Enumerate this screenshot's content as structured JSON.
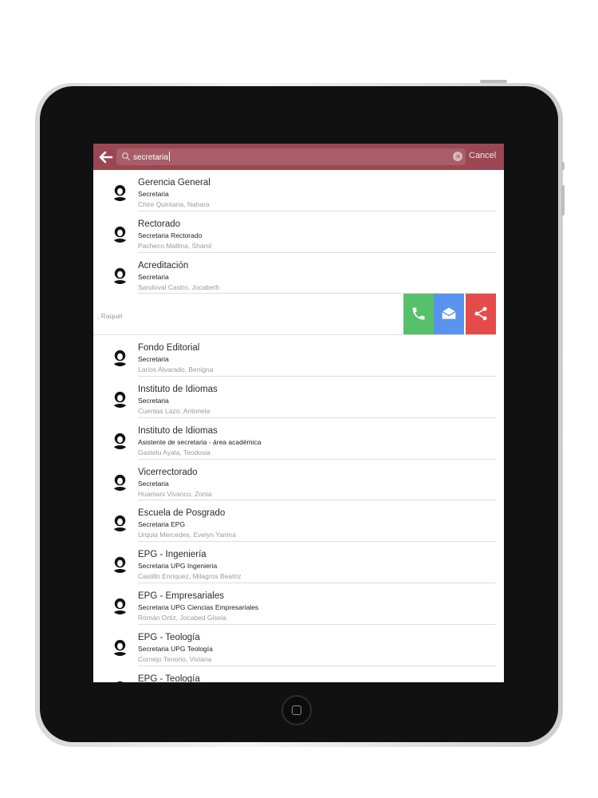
{
  "search": {
    "value": "secretaria",
    "cancel_label": "Cancel"
  },
  "contacts": [
    {
      "title": "Gerencia General",
      "role": "Secretaria",
      "person": "Chire Quintana, Nahara"
    },
    {
      "title": "Rectorado",
      "role": "Secretaria Rectorado",
      "person": "Pacheco Mallma, Sharol"
    },
    {
      "title": "Acreditación",
      "role": "Secretaria",
      "person": "Sandoval Castro, Jocabeth"
    },
    {
      "title": "",
      "role": "",
      "person": ", Raquel"
    },
    {
      "title": "Fondo Editorial",
      "role": "Secretaria",
      "person": "Larios Alvarado, Benigna"
    },
    {
      "title": "Instituto de Idiomas",
      "role": "Secretaria",
      "person": "Cuentas Lazo, Antonela"
    },
    {
      "title": "Instituto de Idiomas",
      "role": "Asistente de secretaria - área académica",
      "person": "Gastelu Ayala, Teodosia"
    },
    {
      "title": "Vicerrectorado",
      "role": "Secretaria",
      "person": "Huamani Vivanco, Zonia"
    },
    {
      "title": "Escuela de Posgrado",
      "role": "Secretaria EPG",
      "person": "Urquia Mercedes, Evelyn Yanina"
    },
    {
      "title": "EPG - Ingeniería",
      "role": "Secretaria UPG Ingenieria",
      "person": "Castillo Enriquez, Milagros Beatriz"
    },
    {
      "title": "EPG - Empresariales",
      "role": "Secretaria UPG Ciencias Empresariales",
      "person": "Román Ortiz, Jocabed Gisela"
    },
    {
      "title": "EPG - Teología",
      "role": "Secretaria UPG Teología",
      "person": "Cornejo Tenorio, Viviana"
    },
    {
      "title": "EPG - Teología",
      "role": "",
      "person": ""
    }
  ],
  "swipe_actions": [
    {
      "name": "call",
      "icon": "phone-icon",
      "color": "#57c06a"
    },
    {
      "name": "email",
      "icon": "envelope-icon",
      "color": "#5a93ee"
    },
    {
      "name": "share",
      "icon": "share-icon",
      "color": "#e64b4b"
    }
  ],
  "colors": {
    "header": "#9a4753",
    "call": "#57c06a",
    "email": "#5a93ee",
    "share": "#e64b4b"
  }
}
